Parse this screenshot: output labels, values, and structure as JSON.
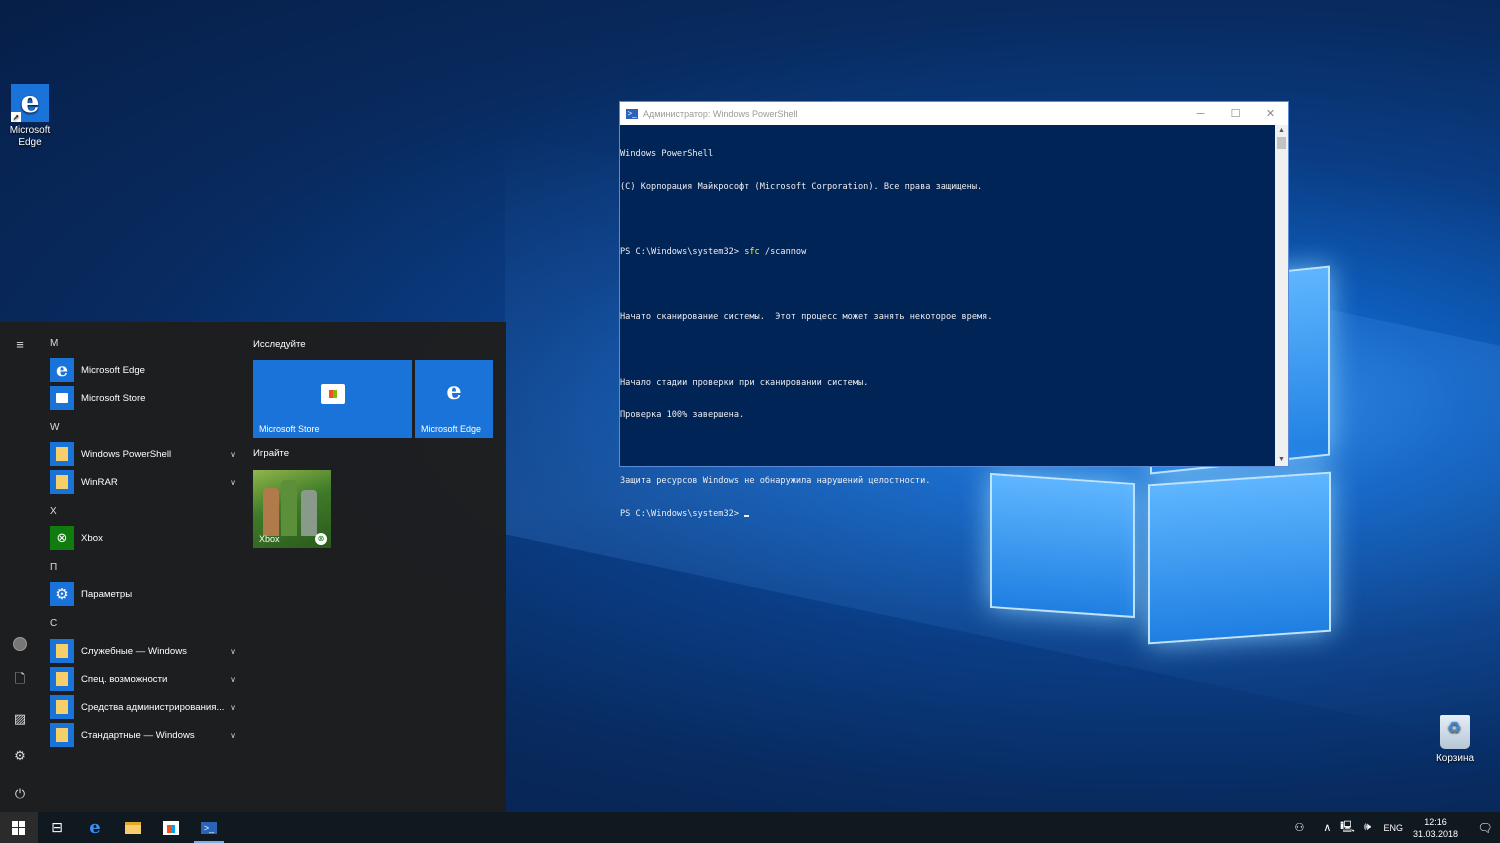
{
  "desktop": {
    "icons": [
      {
        "label_line1": "Microsoft",
        "label_line2": "Edge"
      },
      {
        "label": "Корзина"
      }
    ]
  },
  "powershell": {
    "title": "Администратор: Windows PowerShell",
    "lines": [
      "Windows PowerShell",
      "(C) Корпорация Майкрософт (Microsoft Corporation). Все права защищены.",
      "",
      "PS C:\\Windows\\system32> ",
      "",
      "Начато сканирование системы.  Этот процесс может занять некоторое время.",
      "",
      "Начало стадии проверки при сканировании системы.",
      "Проверка 100% завершена.",
      "",
      "Защита ресурсов Windows не обнаружила нарушений целостности.",
      "PS C:\\Windows\\system32> "
    ],
    "command_keyword": "sfc",
    "command_args": " /scannow"
  },
  "start_menu": {
    "letters": [
      "M",
      "W",
      "X",
      "П",
      "С"
    ],
    "apps": [
      {
        "label": "Microsoft Edge"
      },
      {
        "label": "Microsoft Store"
      },
      {
        "label": "Windows PowerShell"
      },
      {
        "label": "WinRAR"
      },
      {
        "label": "Xbox"
      },
      {
        "label": "Параметры"
      },
      {
        "label": "Служебные — Windows"
      },
      {
        "label": "Спец. возможности"
      },
      {
        "label": "Средства администрирования..."
      },
      {
        "label": "Стандартные — Windows"
      }
    ],
    "groups": [
      "Исследуйте",
      "Играйте"
    ],
    "tiles": [
      {
        "label": "Microsoft Store"
      },
      {
        "label": "Microsoft Edge"
      },
      {
        "label": "Xbox"
      }
    ]
  },
  "taskbar": {
    "language": "ENG",
    "time": "12:16",
    "date": "31.03.2018"
  },
  "colors": {
    "ps_background": "#012456",
    "accent": "#1a73d9",
    "xbox_green": "#107c10"
  }
}
